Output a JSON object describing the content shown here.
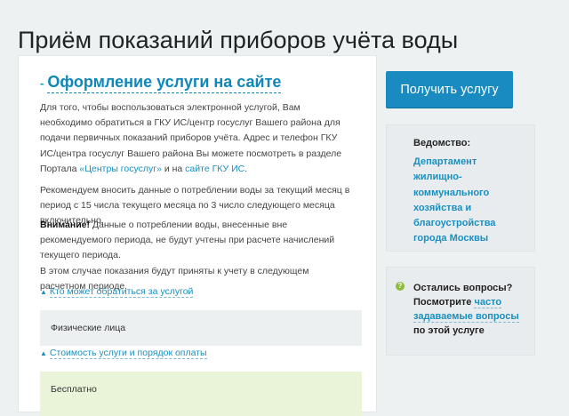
{
  "page": {
    "title": "Приём показаний приборов учёта воды"
  },
  "section": {
    "title": "Оформление услуги на сайте"
  },
  "paragraph1": {
    "text_a": "Для того, чтобы воспользоваться электронной услугой, Вам необходимо обратиться в ГКУ ИС/центр госуслуг Вашего района для подачи первичных показаний приборов учёта. Адрес и телефон ГКУ ИС/центра госуслуг Вашего района Вы можете посмотреть в разделе Портала ",
    "link1": "«Центры госуслуг»",
    "text_b": " и на ",
    "link2": "сайте ГКУ ИС",
    "text_c": "."
  },
  "paragraph2": {
    "text": "Рекомендуем вносить данные о потреблении воды за текущий месяц в период с 15 числа текущего месяца по 3 число следующего месяца включительно."
  },
  "paragraph3": {
    "strong": "Внимание!",
    "text_a": " Данные о потреблении воды, внесенные вне рекомендуемого периода, не будут учтены при расчете начислений текущего периода.",
    "text_b": "В этом случае показания будут приняты к учету в следующем расчетном периоде."
  },
  "toggles": {
    "who_can_apply": "Кто может обратиться за услугой",
    "cost": "Стоимость услуги и порядок оплаты"
  },
  "boxes": {
    "applicants": "Физические лица",
    "price": "Бесплатно"
  },
  "sidebar": {
    "button_label": "Получить услугу",
    "agency_label": "Ведомство:",
    "agency_name": "Департамент жилищно-коммунального хозяйства и благоустройства города Москвы",
    "questions_title": "Остались вопросы?",
    "questions_text_a": "Посмотрите ",
    "questions_link": "часто задаваемые вопросы",
    "questions_text_b": " по этой услуге"
  },
  "colors": {
    "accent": "#1a8bc0",
    "link": "#1a8fbf",
    "price_box": "#e9f4d9",
    "question_icon": "#8cbb3c"
  },
  "icons": {
    "toggle": "caret-up-icon",
    "question": "question-circle-icon"
  }
}
